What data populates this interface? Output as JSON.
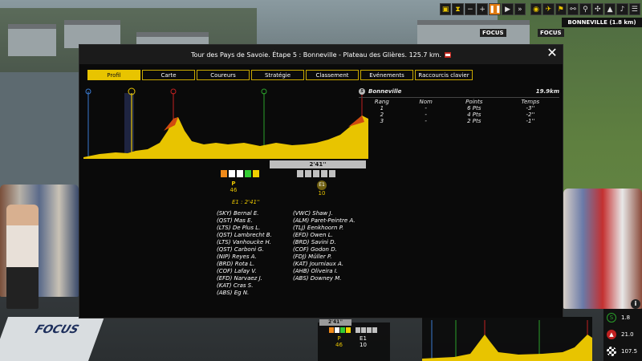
{
  "hud": {
    "town": "BONNEVILLE (1.8 km)",
    "stats": [
      {
        "icon": "sprint-icon",
        "value": "1.8"
      },
      {
        "icon": "climb-icon",
        "value": "21.0"
      },
      {
        "icon": "finish-flag-icon",
        "value": "107.5"
      }
    ]
  },
  "modal": {
    "title": "Tour des Pays de Savoie. Étape 5 : Bonneville - Plateau des Glières. 125.7 km.",
    "tabs": [
      "Profil",
      "Carte",
      "Coureurs",
      "Stratégie",
      "Classement",
      "Evénements",
      "Raccourcis clavier"
    ],
    "active_tab": "Profil"
  },
  "race": {
    "gap": "2'41''",
    "groups": [
      {
        "id": "P",
        "count": "46",
        "jerseys": [
          "#f08a1a",
          "#ffffff",
          "#ffffff",
          "#33cc33",
          "#f0d000"
        ]
      },
      {
        "id": "E1",
        "count": "10",
        "jerseys": [
          "#c0c0c0",
          "#c0c0c0",
          "#c0c0c0",
          "#c0c0c0",
          "#c0c0c0"
        ]
      }
    ],
    "e1_gap_label": "E1 : 2'41''",
    "peloton_riders": [
      "(SKY) Bernal E.",
      "(QST) Mas E.",
      "(LTS) De Plus L.",
      "(QST) Lambrecht B.",
      "(LTS) Vanhoucke H.",
      "(QST) Carboni G.",
      "(NIP) Reyes A.",
      "(BRD) Rota L.",
      "(COF) Lafay V.",
      "(EFD) Narvaez J.",
      "(KAT) Cras S.",
      "(ABS) Eg N."
    ],
    "breakaway_riders": [
      "(VWC) Shaw J.",
      "(ALM) Paret-Peintre A.",
      "(TLJ) Eenkhoorn P.",
      "(EFD) Owen L.",
      "(BRD) Savini D.",
      "(COF) Godon D.",
      "(FDJ) Müller P.",
      "(KAT) Journiaux A.",
      "(AHB) Oliveira I.",
      "(ABS) Downey M."
    ]
  },
  "sprint": {
    "name": "Bonneville",
    "km": "19.9km",
    "headers": [
      "Rang",
      "Nom",
      "Points",
      "Temps"
    ],
    "rows": [
      [
        "1",
        "-",
        "6 Pts",
        "-3''"
      ],
      [
        "2",
        "-",
        "4 Pts",
        "-2''"
      ],
      [
        "3",
        "-",
        "2 Pts",
        "-1''"
      ]
    ]
  }
}
